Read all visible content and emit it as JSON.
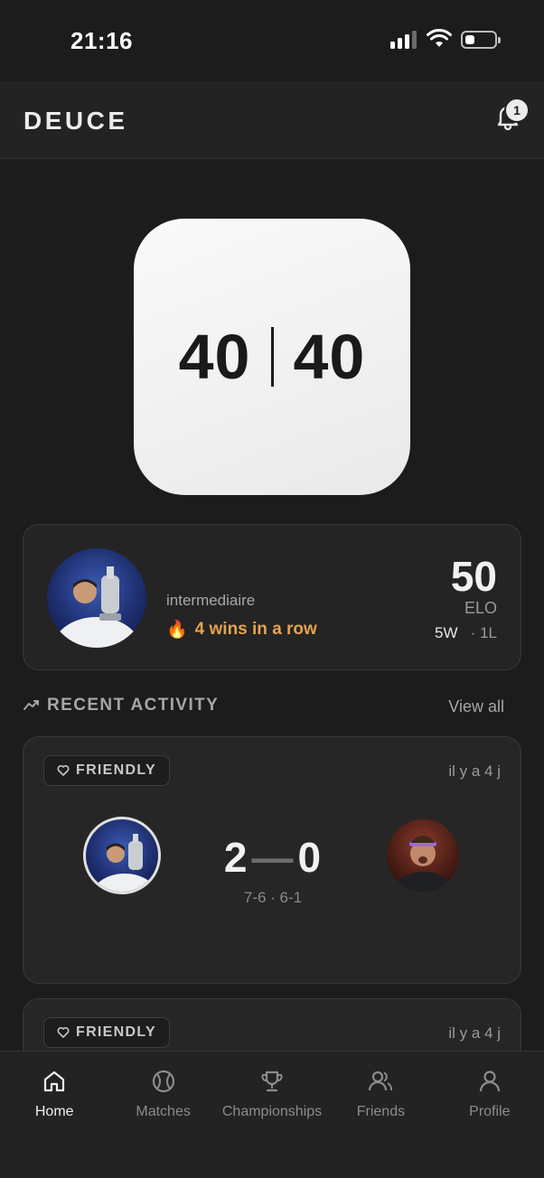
{
  "status_bar": {
    "time": "21:16"
  },
  "header": {
    "title": "DEUCE",
    "notification_count": "1"
  },
  "score": {
    "left": "40",
    "right": "40"
  },
  "player": {
    "level": "intermediaire",
    "streak_emoji": "🔥",
    "streak_text": "4 wins in a row",
    "elo_value": "50",
    "elo_label": "ELO",
    "wins": "5W",
    "losses": "· 1L"
  },
  "recent_activity": {
    "title": "RECENT ACTIVITY",
    "view_all": "View all",
    "matches": [
      {
        "tag": "FRIENDLY",
        "time": "il y a 4 j",
        "score_a": "2",
        "score_b": "0",
        "sets": "7-6 · 6-1"
      },
      {
        "tag": "FRIENDLY",
        "time": "il y a 4 j"
      }
    ]
  },
  "tabs": [
    {
      "label": "Home",
      "icon": "home-icon",
      "active": true
    },
    {
      "label": "Matches",
      "icon": "tennis-ball-icon"
    },
    {
      "label": "Championships",
      "icon": "trophy-icon"
    },
    {
      "label": "Friends",
      "icon": "users-icon"
    },
    {
      "label": "Profile",
      "icon": "user-icon"
    }
  ],
  "colors": {
    "background": "#1c1c1c",
    "card": "#242424",
    "streak": "#e6a24c",
    "score_card": "#f2f2f2"
  }
}
